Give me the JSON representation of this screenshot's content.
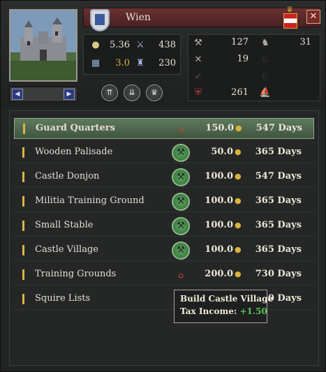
{
  "holding": {
    "name": "Wien",
    "close_label": "✕"
  },
  "stats": {
    "gold_income": "5.36",
    "levy": "438",
    "tech": "3.0",
    "garrison": "230",
    "gold_color": "#d8b43a"
  },
  "units": [
    {
      "icon": "light-infantry-icon",
      "value": "127"
    },
    {
      "icon": "cavalry-icon",
      "value": "31"
    },
    {
      "icon": "heavy-infantry-icon",
      "value": "19"
    },
    {
      "icon": "archers-icon",
      "value": ""
    },
    {
      "icon": "pikemen-icon",
      "value": ""
    },
    {
      "icon": "horse-archers-icon",
      "value": ""
    },
    {
      "icon": "knights-icon",
      "value": "261"
    },
    {
      "icon": "galleys-icon",
      "value": ""
    }
  ],
  "buildings": [
    {
      "name": "Guard Quarters",
      "cost": "150.0",
      "days": "547 Days",
      "status": "under-construction",
      "selected": true
    },
    {
      "name": "Wooden Palisade",
      "cost": "50.0",
      "days": "365 Days",
      "status": "buildable",
      "selected": false
    },
    {
      "name": "Castle Donjon",
      "cost": "100.0",
      "days": "547 Days",
      "status": "buildable",
      "selected": false
    },
    {
      "name": "Militia Training Ground",
      "cost": "100.0",
      "days": "365 Days",
      "status": "buildable",
      "selected": false
    },
    {
      "name": "Small Stable",
      "cost": "100.0",
      "days": "365 Days",
      "status": "buildable",
      "selected": false
    },
    {
      "name": "Castle Village",
      "cost": "100.0",
      "days": "365 Days",
      "status": "buildable",
      "selected": false
    },
    {
      "name": "Training Grounds",
      "cost": "200.0",
      "days": "730 Days",
      "status": "under-construction",
      "selected": false
    },
    {
      "name": "Squire Lists",
      "cost": "",
      "days": "730 Days",
      "status": "none",
      "selected": false
    }
  ],
  "tooltip": {
    "title": "Build Castle Village",
    "label": "Tax Income:",
    "value": "+1.50",
    "value_color": "#58c054"
  }
}
